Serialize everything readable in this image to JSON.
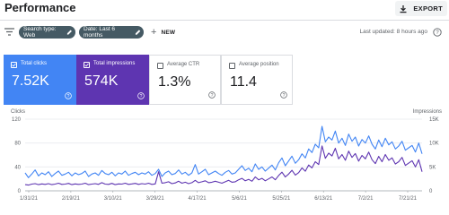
{
  "header": {
    "title": "Performance",
    "export_label": "EXPORT"
  },
  "filters": {
    "chips": [
      "Search type: Web",
      "Date: Last 6 months"
    ],
    "new_label": "NEW",
    "last_updated": "Last updated: 8 hours ago"
  },
  "metrics": [
    {
      "label": "Total clicks",
      "value": "7.52K",
      "selected": true,
      "color": "#4285f4"
    },
    {
      "label": "Total impressions",
      "value": "574K",
      "selected": true,
      "color": "#5e35b1"
    },
    {
      "label": "Average CTR",
      "value": "1.3%",
      "selected": false
    },
    {
      "label": "Average position",
      "value": "11.4",
      "selected": false
    }
  ],
  "chart_data": {
    "type": "line",
    "ylabel_left": "Clicks",
    "ylabel_right": "Impressions",
    "y_left_ticks": [
      "120",
      "80",
      "40",
      "0"
    ],
    "y_right_ticks": [
      "15K",
      "10K",
      "5K",
      "0"
    ],
    "ylim_left": [
      0,
      120
    ],
    "ylim_right": [
      0,
      15000
    ],
    "x_tick_labels": [
      "1/31/21",
      "2/19/21",
      "3/10/21",
      "3/29/21",
      "4/17/21",
      "5/6/21",
      "5/25/21",
      "6/13/21",
      "7/2/21",
      "7/21/21"
    ],
    "grid": true,
    "series": [
      {
        "name": "Clicks",
        "axis": "left",
        "color": "#4285f4",
        "values": [
          30,
          22,
          28,
          35,
          25,
          30,
          27,
          32,
          24,
          29,
          33,
          26,
          28,
          31,
          25,
          30,
          27,
          29,
          33,
          24,
          28,
          30,
          26,
          34,
          29,
          27,
          31,
          25,
          30,
          28,
          33,
          26,
          29,
          31,
          27,
          30,
          28,
          32,
          26,
          29,
          36,
          24,
          30,
          33,
          27,
          29,
          35,
          28,
          31,
          26,
          30,
          44,
          28,
          32,
          36,
          27,
          30,
          33,
          29,
          26,
          31,
          34,
          28,
          30,
          36,
          42,
          34,
          38,
          32,
          45,
          36,
          40,
          33,
          38,
          43,
          35,
          47,
          55,
          42,
          50,
          58,
          46,
          52,
          62,
          55,
          70,
          64,
          78,
          72,
          108,
          82,
          90,
          85,
          100,
          80,
          88,
          76,
          95,
          83,
          90,
          75,
          86,
          80,
          92,
          78,
          70,
          85,
          74,
          88,
          77,
          82,
          70,
          75,
          83,
          68,
          72,
          76,
          65,
          80,
          62
        ]
      },
      {
        "name": "Impressions",
        "axis": "right",
        "color": "#5e35b1",
        "values": [
          1300,
          1200,
          1400,
          1500,
          1300,
          1450,
          1350,
          1500,
          1300,
          1400,
          1600,
          1350,
          1400,
          1550,
          1300,
          1450,
          1350,
          1400,
          1600,
          1300,
          1400,
          1500,
          1350,
          1700,
          1400,
          1350,
          1550,
          1300,
          1450,
          1400,
          1600,
          1350,
          1450,
          1550,
          1350,
          1500,
          1400,
          1600,
          1350,
          1450,
          4000,
          1600,
          1700,
          1900,
          1500,
          1650,
          2000,
          1600,
          1800,
          1500,
          1700,
          2200,
          1700,
          1900,
          2100,
          1700,
          1800,
          2000,
          1800,
          1600,
          1900,
          2200,
          1800,
          1900,
          2300,
          2600,
          2100,
          2400,
          2000,
          2900,
          2300,
          2600,
          2100,
          2500,
          2900,
          2300,
          3200,
          3900,
          2900,
          3500,
          4300,
          3300,
          3800,
          4800,
          4100,
          5400,
          4800,
          6100,
          5500,
          9400,
          6800,
          7900,
          7300,
          8900,
          6700,
          7600,
          6400,
          8300,
          7000,
          7800,
          6200,
          7400,
          6700,
          8100,
          6500,
          5700,
          7200,
          6100,
          7600,
          6400,
          6900,
          5600,
          6100,
          7000,
          5300,
          5800,
          6300,
          5000,
          6500,
          4000
        ]
      }
    ]
  }
}
